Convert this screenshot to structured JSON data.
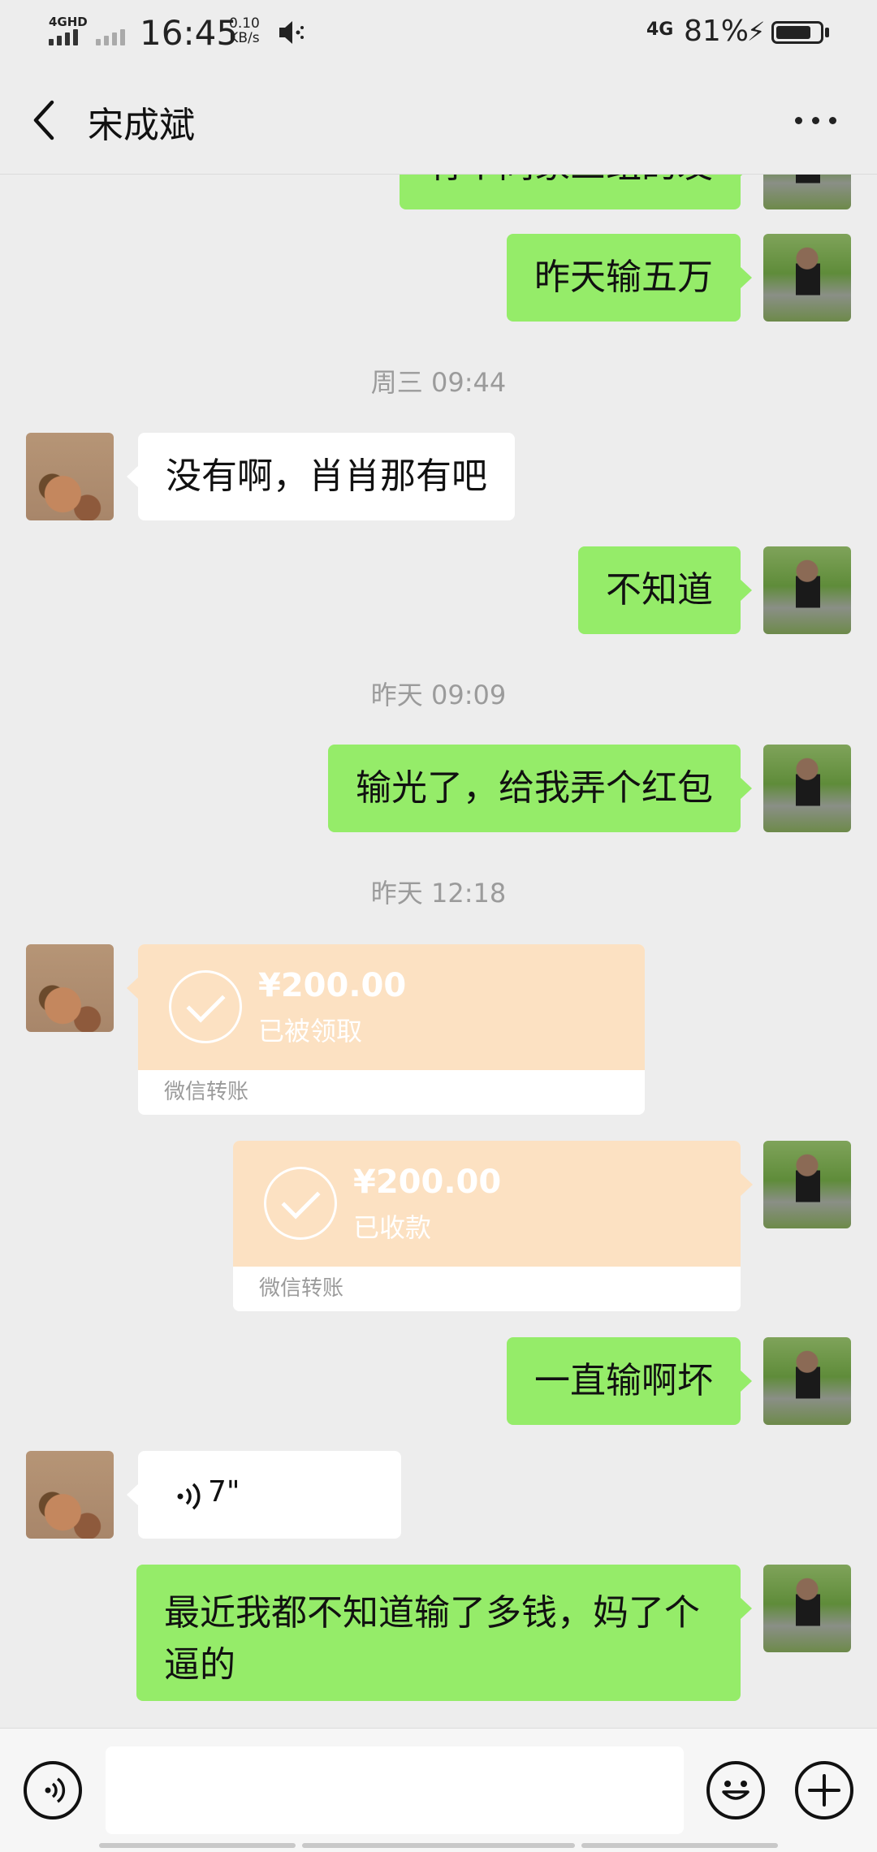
{
  "status_bar": {
    "network": "4GHD",
    "time": "16:45",
    "speed_value": "0.10",
    "speed_unit": "KB/s",
    "network_right": "4G",
    "battery": "81%",
    "battery_level": 0.81,
    "icons": [
      "signal-icon",
      "mute-speaker-icon",
      "charging-bolt-icon",
      "battery-icon"
    ]
  },
  "header": {
    "title": "宋成斌",
    "back_icon": "chevron-left-icon",
    "more_icon": "more-dots-icon"
  },
  "messages": [
    {
      "type": "text",
      "from": "me",
      "text": "有个同家三组的发",
      "partial": true
    },
    {
      "type": "text",
      "from": "me",
      "text": "昨天输五万"
    },
    {
      "type": "time",
      "text": "周三 09:44"
    },
    {
      "type": "text",
      "from": "other",
      "text": "没有啊，肖肖那有吧"
    },
    {
      "type": "text",
      "from": "me",
      "text": "不知道"
    },
    {
      "type": "time",
      "text": "昨天 09:09"
    },
    {
      "type": "text",
      "from": "me",
      "text": "输光了，给我弄个红包"
    },
    {
      "type": "time",
      "text": "昨天 12:18"
    },
    {
      "type": "transfer",
      "from": "other",
      "amount": "¥200.00",
      "status": "已被领取",
      "label": "微信转账"
    },
    {
      "type": "transfer",
      "from": "me",
      "amount": "¥200.00",
      "status": "已收款",
      "label": "微信转账"
    },
    {
      "type": "text",
      "from": "me",
      "text": "一直输啊坏"
    },
    {
      "type": "voice",
      "from": "other",
      "duration": "7\""
    },
    {
      "type": "text",
      "from": "me",
      "text": "最近我都不知道输了多钱，妈了个逼的"
    }
  ],
  "input_bar": {
    "placeholder": "",
    "icons": [
      "voice-input-icon",
      "emoji-icon",
      "plus-icon"
    ]
  }
}
